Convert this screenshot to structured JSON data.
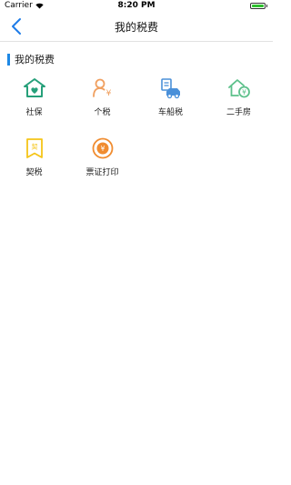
{
  "status_bar": {
    "carrier": "Carrier",
    "time": "8:20 PM"
  },
  "nav": {
    "title": "我的税费",
    "back_icon": "chevron-left-icon"
  },
  "section": {
    "title": "我的税费",
    "accent_color": "#1e88e5"
  },
  "tiles": [
    {
      "label": "社保",
      "icon": "social-insurance-icon",
      "color": "#26a07a"
    },
    {
      "label": "个税",
      "icon": "personal-tax-icon",
      "color": "#f0a060"
    },
    {
      "label": "车船税",
      "icon": "vehicle-tax-icon",
      "color": "#4a90d9"
    },
    {
      "label": "二手房",
      "icon": "second-hand-house-icon",
      "color": "#5cc08a"
    },
    {
      "label": "契税",
      "icon": "deed-tax-icon",
      "color": "#f5c518"
    },
    {
      "label": "票证打印",
      "icon": "receipt-print-icon",
      "color": "#f08c30"
    }
  ]
}
